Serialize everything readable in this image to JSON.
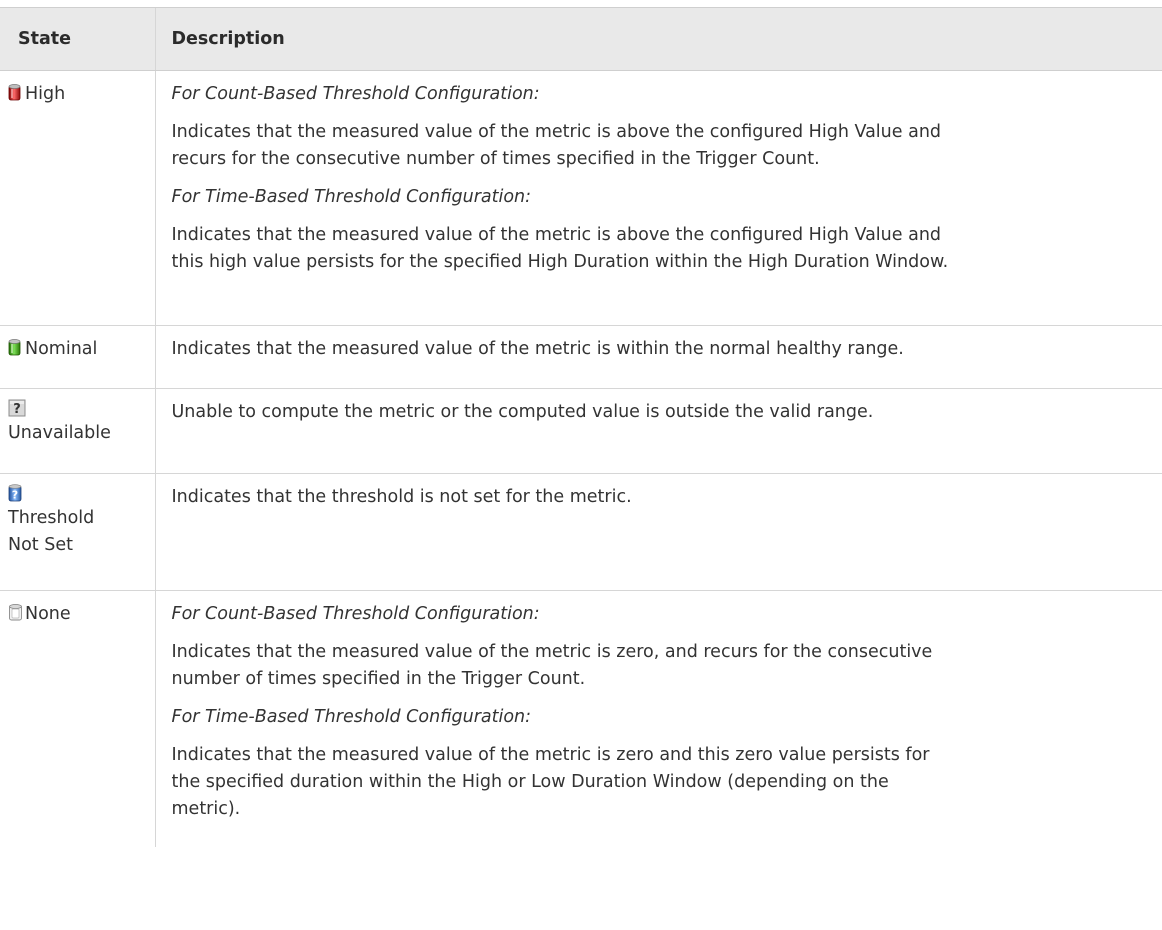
{
  "table": {
    "headers": {
      "state": "State",
      "description": "Description"
    },
    "rows": [
      {
        "state": "High",
        "icon": "red-cylinder-icon",
        "paragraphs": [
          {
            "text": "For Count-Based Threshold Configuration:",
            "italic": true
          },
          {
            "line1": "Indicates that the measured value of the metric is above the configured High Value and",
            "line2": "recurs for the consecutive number of times specified in the Trigger Count."
          },
          {
            "text": "For Time-Based Threshold Configuration:",
            "italic": true
          },
          {
            "line1": "Indicates that the measured value of the metric is above the configured High Value and",
            "line2": "this high value persists for the specified High Duration within the High Duration Window."
          }
        ]
      },
      {
        "state": "Nominal",
        "icon": "green-cylinder-icon",
        "text": "Indicates that the measured value of the metric is within the normal healthy range."
      },
      {
        "state": "Unavailable",
        "icon": "gray-question-icon",
        "text": "Unable to compute the metric or the computed value is outside the valid range."
      },
      {
        "state_line1": "Threshold",
        "state_line2": "Not Set",
        "icon": "blue-question-icon",
        "text": "Indicates that the threshold is not set for the metric."
      },
      {
        "state": "None",
        "icon": "empty-cylinder-icon",
        "paragraphs": [
          {
            "text": "For Count-Based Threshold Configuration:",
            "italic": true
          },
          {
            "line1": "Indicates that the measured value of the metric is zero, and recurs for the consecutive",
            "line2": "number of times specified in the Trigger Count."
          },
          {
            "text": "For Time-Based Threshold Configuration:",
            "italic": true
          },
          {
            "line1": "Indicates that the measured value of the metric is zero and this zero value persists for",
            "line2": "the specified duration within the High or Low Duration Window (depending on the",
            "line3": "metric)."
          }
        ]
      }
    ]
  }
}
